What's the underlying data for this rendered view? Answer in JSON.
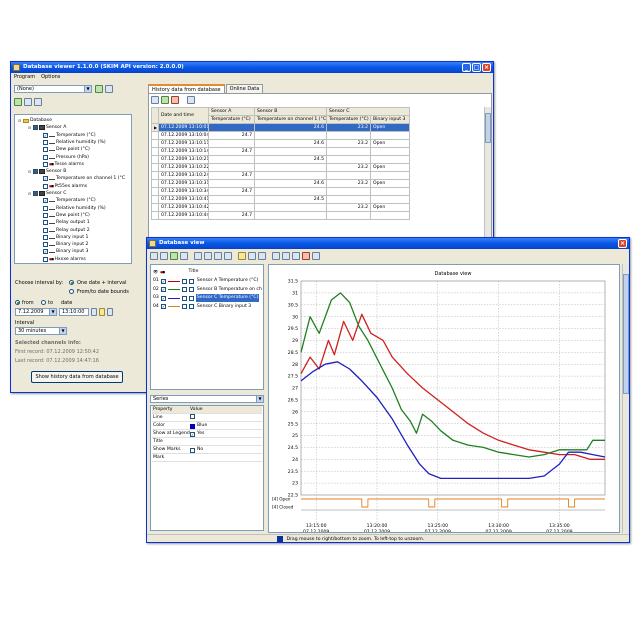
{
  "db_window": {
    "title": "Database viewer   1.1.0.0  (SKIM API version: 2.0.0.0)",
    "menu": [
      "Program",
      "Options"
    ],
    "source_select": "(None)",
    "tree": [
      {
        "label": "Database",
        "kind": "folder",
        "indent": 0
      },
      {
        "label": "Sensor A",
        "kind": "device",
        "indent": 1
      },
      {
        "label": "Temperature (°C)",
        "kind": "channel",
        "indent": 2,
        "checked": true
      },
      {
        "label": "Relative humidity (%)",
        "kind": "channel",
        "indent": 2,
        "checked": false
      },
      {
        "label": "Dew point (°C)",
        "kind": "channel",
        "indent": 2,
        "checked": false
      },
      {
        "label": "Pressure (hPa)",
        "kind": "channel",
        "indent": 2,
        "checked": false
      },
      {
        "label": "Tesse alarms",
        "kind": "alarm",
        "indent": 2,
        "checked": false
      },
      {
        "label": "Sensor B",
        "kind": "device",
        "indent": 1
      },
      {
        "label": "Temperature on channel 1 (°C",
        "kind": "channel",
        "indent": 2,
        "checked": true
      },
      {
        "label": "Pt55es alarms",
        "kind": "alarm",
        "indent": 2,
        "checked": false
      },
      {
        "label": "Sensor C",
        "kind": "device",
        "indent": 1
      },
      {
        "label": "Temperature (°C)",
        "kind": "channel",
        "indent": 2,
        "checked": true
      },
      {
        "label": "Relative humidity (%)",
        "kind": "channel",
        "indent": 2,
        "checked": false
      },
      {
        "label": "Dew point (°C)",
        "kind": "channel",
        "indent": 2,
        "checked": false
      },
      {
        "label": "Relay output 1",
        "kind": "binary",
        "indent": 2,
        "checked": false
      },
      {
        "label": "Relay output 2",
        "kind": "binary",
        "indent": 2,
        "checked": false
      },
      {
        "label": "Binary input 1",
        "kind": "binary",
        "indent": 2,
        "checked": false
      },
      {
        "label": "Binary input 2",
        "kind": "binary",
        "indent": 2,
        "checked": false
      },
      {
        "label": "Binary input 3",
        "kind": "binary",
        "indent": 2,
        "checked": true
      },
      {
        "label": "Hxxxe alarms",
        "kind": "alarm",
        "indent": 2,
        "checked": false
      }
    ],
    "interval_label": "Choose interval by:",
    "option_one": "One date + interval",
    "option_two": "From/to date bounds",
    "from_label": "from",
    "to_label": "to",
    "date_label": "date",
    "date_value": "7.12.2009",
    "time_value": "13:10:00",
    "interval_heading": "Interval",
    "interval_value": "30 minutes",
    "info_heading": "Selected channels info:",
    "first_record": "First record: 07.12.2009 12:50:42",
    "last_record": "Last record: 07.12.2009 14:47:16",
    "show_button": "Show history data from database",
    "tabs": [
      "History data from database",
      "Online Data"
    ],
    "table": {
      "group_headers": [
        "Sensor A",
        "Sensor B",
        "Sensor C"
      ],
      "headers": [
        "Date and time",
        "Temperature (°C)",
        "Temperature on channel 1 (°C)",
        "Temperature (°C)",
        "Binary input 3"
      ],
      "rows": [
        [
          "07.12.2009 13:10:01",
          "",
          "24.6",
          "23.2",
          "Open"
        ],
        [
          "07.12.2009 13:10:04",
          "24.7",
          "",
          "",
          ""
        ],
        [
          "07.12.2009 13:10:11",
          "",
          "24.6",
          "23.2",
          "Open"
        ],
        [
          "07.12.2009 13:10:14",
          "24.7",
          "",
          "",
          ""
        ],
        [
          "07.12.2009 13:10:21",
          "",
          "24.5",
          "",
          ""
        ],
        [
          "07.12.2009 13:10:22",
          "",
          "",
          "23.2",
          "Open"
        ],
        [
          "07.12.2009 13:10:24",
          "24.7",
          "",
          "",
          ""
        ],
        [
          "07.12.2009 13:10:31",
          "",
          "24.6",
          "23.2",
          "Open"
        ],
        [
          "07.12.2009 13:10:34",
          "24.7",
          "",
          "",
          ""
        ],
        [
          "07.12.2009 13:10:41",
          "",
          "24.5",
          "",
          ""
        ],
        [
          "07.12.2009 13:10:42",
          "",
          "",
          "23.2",
          "Open"
        ],
        [
          "07.12.2009 13:10:44",
          "24.7",
          "",
          "",
          ""
        ]
      ]
    }
  },
  "view_window": {
    "title": "Database view",
    "series_header": "Title",
    "series_list": [
      {
        "num": "01",
        "name": "Sensor A Temperature (°C)",
        "color": "#c00000",
        "selected": false
      },
      {
        "num": "02",
        "name": "Sensor B Temperature on ch",
        "color": "#208020",
        "selected": false
      },
      {
        "num": "03",
        "name": "Sensor C Temperature (°C)",
        "color": "#2020c0",
        "selected": true
      },
      {
        "num": "04",
        "name": "Sensor C Binary input 3",
        "color": "#e08020",
        "selected": false
      }
    ],
    "props_select": "Series",
    "props_header": [
      "Property",
      "Value"
    ],
    "props": [
      {
        "key": "Line",
        "value": ""
      },
      {
        "key": "Color",
        "value": "Blue",
        "swatch": "#0000c0"
      },
      {
        "key": "Show at Legend",
        "value": "Yes",
        "check": true
      },
      {
        "key": "Title",
        "value": ""
      },
      {
        "key": "Show Marks",
        "value": "No",
        "check": false
      },
      {
        "key": "Mark",
        "value": ""
      }
    ],
    "status_text": "Drag mouse to right/bottom to zoom. To left-top to unzoom."
  },
  "chart_data": {
    "type": "line",
    "title": "Database view",
    "ylim": [
      22.5,
      31.5
    ],
    "yticks": [
      "31.5",
      "31",
      "30.5",
      "30",
      "29.5",
      "29",
      "28.5",
      "28",
      "27.5",
      "27",
      "26.5",
      "26",
      "25.5",
      "25",
      "24.5",
      "24",
      "23.5",
      "23",
      "22.5"
    ],
    "xticks": [
      {
        "t": 0.05,
        "time": "13:15:00",
        "date": "07.12.2009"
      },
      {
        "t": 0.25,
        "time": "13:20:00",
        "date": "07.12.2009"
      },
      {
        "t": 0.45,
        "time": "13:25:00",
        "date": "07.12.2009"
      },
      {
        "t": 0.65,
        "time": "13:30:00",
        "date": "07.12.2009"
      },
      {
        "t": 0.85,
        "time": "13:35:00",
        "date": "07.12.2009"
      }
    ],
    "grid": true,
    "binary_labels": [
      "[4] Open",
      "[4] Closed"
    ],
    "series": [
      {
        "name": "Sensor A Temperature (°C)",
        "color": "#d02020",
        "points": [
          [
            0,
            27.6
          ],
          [
            0.03,
            28.3
          ],
          [
            0.06,
            27.8
          ],
          [
            0.09,
            29.0
          ],
          [
            0.11,
            28.4
          ],
          [
            0.14,
            29.8
          ],
          [
            0.17,
            29.0
          ],
          [
            0.2,
            30.1
          ],
          [
            0.23,
            29.3
          ],
          [
            0.27,
            29.0
          ],
          [
            0.3,
            28.3
          ],
          [
            0.35,
            27.6
          ],
          [
            0.4,
            27.0
          ],
          [
            0.45,
            26.5
          ],
          [
            0.5,
            26.0
          ],
          [
            0.55,
            25.5
          ],
          [
            0.6,
            25.1
          ],
          [
            0.65,
            24.8
          ],
          [
            0.7,
            24.6
          ],
          [
            0.75,
            24.4
          ],
          [
            0.8,
            24.3
          ],
          [
            0.85,
            24.2
          ],
          [
            0.9,
            24.2
          ],
          [
            0.95,
            24.0
          ],
          [
            1.0,
            24.0
          ]
        ]
      },
      {
        "name": "Sensor B Temperature on ch",
        "color": "#208020",
        "points": [
          [
            0,
            28.5
          ],
          [
            0.03,
            30.0
          ],
          [
            0.06,
            29.3
          ],
          [
            0.1,
            30.7
          ],
          [
            0.13,
            31.0
          ],
          [
            0.16,
            30.6
          ],
          [
            0.19,
            29.6
          ],
          [
            0.22,
            29.0
          ],
          [
            0.26,
            28.0
          ],
          [
            0.3,
            27.0
          ],
          [
            0.33,
            26.1
          ],
          [
            0.36,
            25.6
          ],
          [
            0.38,
            25.1
          ],
          [
            0.4,
            25.9
          ],
          [
            0.43,
            25.6
          ],
          [
            0.46,
            25.2
          ],
          [
            0.5,
            24.8
          ],
          [
            0.55,
            24.6
          ],
          [
            0.6,
            24.5
          ],
          [
            0.65,
            24.3
          ],
          [
            0.7,
            24.2
          ],
          [
            0.75,
            24.1
          ],
          [
            0.8,
            24.2
          ],
          [
            0.85,
            24.4
          ],
          [
            0.9,
            24.4
          ],
          [
            0.94,
            24.4
          ],
          [
            0.96,
            24.8
          ],
          [
            1.0,
            24.8
          ]
        ]
      },
      {
        "name": "Sensor C Temperature (°C)",
        "color": "#2020c0",
        "points": [
          [
            0,
            27.3
          ],
          [
            0.04,
            27.7
          ],
          [
            0.08,
            28.0
          ],
          [
            0.12,
            28.1
          ],
          [
            0.16,
            27.8
          ],
          [
            0.2,
            27.3
          ],
          [
            0.25,
            26.6
          ],
          [
            0.3,
            25.7
          ],
          [
            0.35,
            24.6
          ],
          [
            0.39,
            23.8
          ],
          [
            0.42,
            23.4
          ],
          [
            0.46,
            23.2
          ],
          [
            0.55,
            23.2
          ],
          [
            0.65,
            23.2
          ],
          [
            0.75,
            23.2
          ],
          [
            0.8,
            23.3
          ],
          [
            0.85,
            23.8
          ],
          [
            0.88,
            24.3
          ],
          [
            0.92,
            24.3
          ],
          [
            0.96,
            24.2
          ],
          [
            1.0,
            24.1
          ]
        ]
      },
      {
        "name": "Sensor C Binary input 3",
        "color": "#e08020",
        "binary": true,
        "points": [
          [
            0,
            1
          ],
          [
            0.2,
            1
          ],
          [
            0.2,
            0
          ],
          [
            0.22,
            0
          ],
          [
            0.22,
            1
          ],
          [
            0.42,
            1
          ],
          [
            0.42,
            0
          ],
          [
            0.44,
            0
          ],
          [
            0.44,
            1
          ],
          [
            0.66,
            1
          ],
          [
            0.66,
            0
          ],
          [
            0.68,
            0
          ],
          [
            0.68,
            1
          ],
          [
            0.88,
            1
          ],
          [
            0.88,
            0
          ],
          [
            0.9,
            0
          ],
          [
            0.9,
            1
          ],
          [
            1.0,
            1
          ]
        ]
      }
    ]
  }
}
